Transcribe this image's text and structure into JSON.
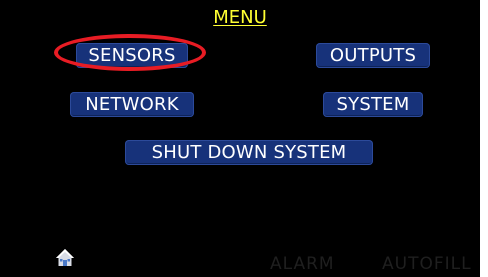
{
  "screen": {
    "title": "MENU"
  },
  "buttons": {
    "sensors": "SENSORS",
    "outputs": "OUTPUTS",
    "network": "NETWORK",
    "system": "SYSTEM",
    "shutdown": "SHUT DOWN SYSTEM"
  },
  "footer": {
    "home_icon": "home-icon",
    "alarm": "ALARM",
    "autofill": "AUTOFILL"
  },
  "colors": {
    "background": "#000000",
    "title": "#ffff33",
    "button_fill": "#17327a",
    "button_text": "#ffffff",
    "highlight": "#e81c24",
    "status_text_dim": "#1f1f1f"
  }
}
